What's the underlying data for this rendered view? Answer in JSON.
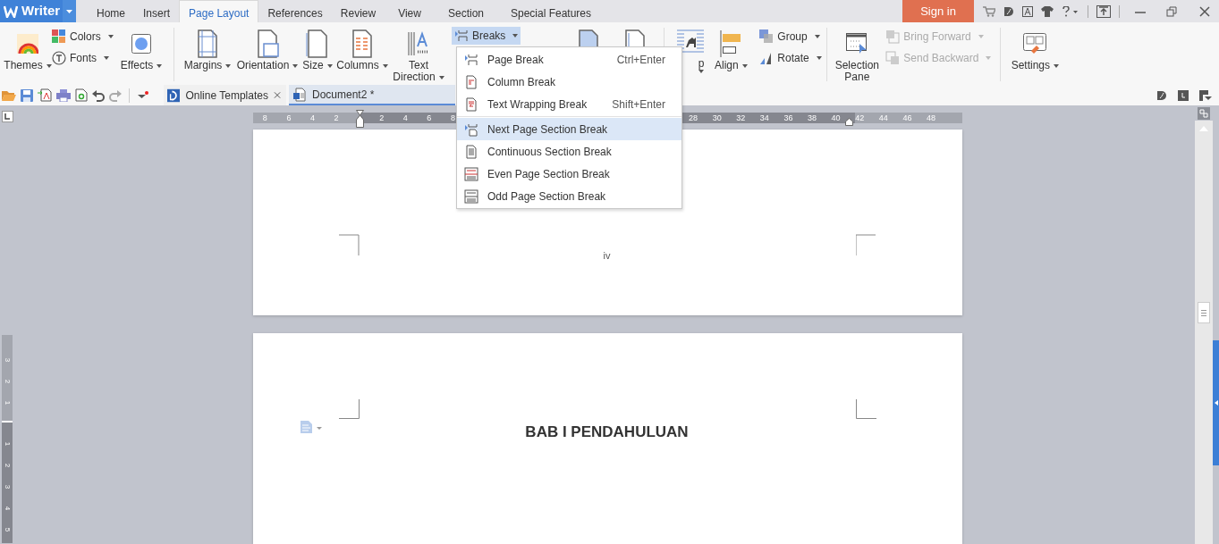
{
  "app": {
    "name": "Writer"
  },
  "menu_tabs": [
    {
      "label": "Home",
      "selected": false
    },
    {
      "label": "Insert",
      "selected": false
    },
    {
      "label": "Page Layout",
      "selected": true
    },
    {
      "label": "References",
      "selected": false
    },
    {
      "label": "Review",
      "selected": false
    },
    {
      "label": "View",
      "selected": false
    },
    {
      "label": "Section",
      "selected": false
    },
    {
      "label": "Special Features",
      "selected": false
    }
  ],
  "sign_in": "Sign in",
  "ribbon": {
    "themes": "Themes",
    "colors": "Colors",
    "fonts": "Fonts",
    "effects": "Effects",
    "margins": "Margins",
    "orientation": "Orientation",
    "size": "Size",
    "columns": "Columns",
    "text_direction": [
      "Text",
      "Direction"
    ],
    "breaks": {
      "label": "Breaks",
      "open": true
    },
    "wrap_cut": "p",
    "align": "Align",
    "group": "Group",
    "rotate": "Rotate",
    "selection_pane": [
      "Selection",
      "Pane"
    ],
    "bring_forward": {
      "label": "Bring Forward",
      "disabled": true
    },
    "send_backward": {
      "label": "Send Backward",
      "disabled": true
    },
    "settings": "Settings"
  },
  "doc_tabs": [
    {
      "label": "Online Templates",
      "selected": false,
      "closable": true
    },
    {
      "label": "Document2 *",
      "selected": true,
      "closable": false
    }
  ],
  "breaks_menu": [
    {
      "label": "Page Break",
      "shortcut": "Ctrl+Enter",
      "selected": false
    },
    {
      "label": "Column Break",
      "selected": false
    },
    {
      "label": "Text Wrapping Break",
      "shortcut": "Shift+Enter",
      "selected": false
    },
    {
      "label": "Next Page Section Break",
      "selected": true
    },
    {
      "label": "Continuous Section Break",
      "selected": false
    },
    {
      "label": "Even Page Section Break",
      "selected": false
    },
    {
      "label": "Odd Page Section Break",
      "selected": false
    }
  ],
  "ruler": {
    "left_numbers": [
      "8",
      "6",
      "4",
      "2"
    ],
    "right_numbers": [
      "2",
      "4",
      "6",
      "8"
    ],
    "far_numbers": [
      "28",
      "30",
      "32",
      "34",
      "36",
      "38",
      "40",
      "42",
      "44",
      "46",
      "48"
    ]
  },
  "vertical_ruler": {
    "top_numbers": [
      "3",
      "2",
      "1"
    ],
    "bottom_numbers": [
      "1",
      "2",
      "3",
      "4",
      "5"
    ]
  },
  "pages": [
    {
      "page_number": "iv"
    },
    {
      "heading": "BAB I PENDAHULUAN"
    }
  ]
}
